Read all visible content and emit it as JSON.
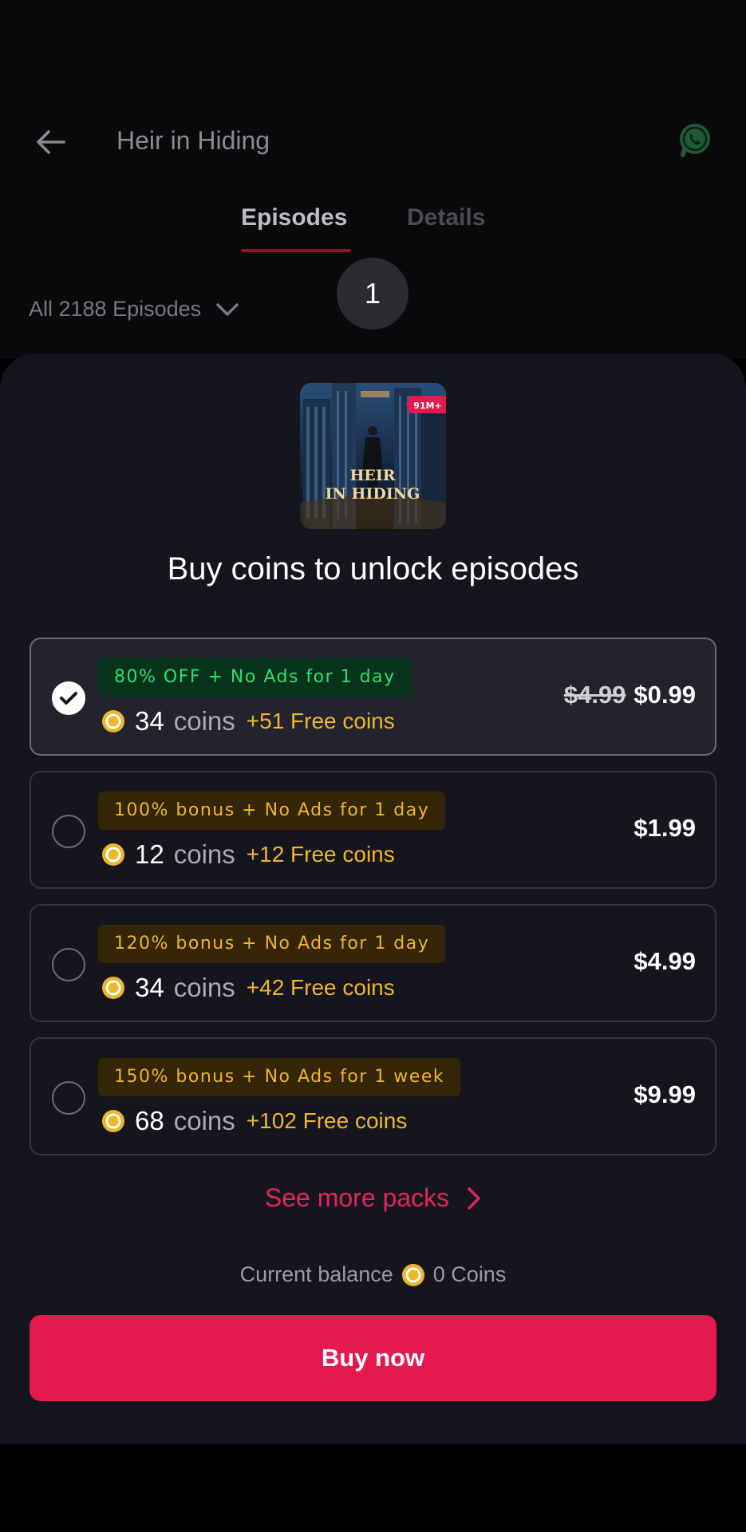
{
  "header": {
    "title": "Heir in Hiding",
    "back_icon": "arrow-left-icon",
    "share_icon": "whatsapp-icon"
  },
  "tabs": [
    {
      "label": "Episodes",
      "active": true
    },
    {
      "label": "Details",
      "active": false
    }
  ],
  "episode_filter": {
    "label": "All 2188 Episodes"
  },
  "current_episode": "1",
  "sheet": {
    "cover": {
      "title_line1": "HEIR",
      "title_line2": "IN HIDING",
      "badge": "91M+"
    },
    "title": "Buy coins to unlock episodes",
    "packs": [
      {
        "badge": "80% OFF + No Ads for 1 day",
        "badge_style": "green",
        "coins": "34",
        "coins_word": "coins",
        "free": "+51 Free coins",
        "old_price": "$4.99",
        "price": "$0.99",
        "selected": true
      },
      {
        "badge": "100% bonus + No Ads for 1 day",
        "badge_style": "gold",
        "coins": "12",
        "coins_word": "coins",
        "free": "+12 Free coins",
        "old_price": "",
        "price": "$1.99",
        "selected": false
      },
      {
        "badge": "120% bonus + No Ads for 1 day",
        "badge_style": "gold",
        "coins": "34",
        "coins_word": "coins",
        "free": "+42 Free coins",
        "old_price": "",
        "price": "$4.99",
        "selected": false
      },
      {
        "badge": "150% bonus + No Ads for 1 week",
        "badge_style": "gold",
        "coins": "68",
        "coins_word": "coins",
        "free": "+102 Free coins",
        "old_price": "",
        "price": "$9.99",
        "selected": false
      }
    ],
    "see_more": "See more packs",
    "balance_label": "Current balance",
    "balance_value": "0 Coins",
    "buy_button": "Buy now"
  },
  "colors": {
    "accent": "#e5194e",
    "coin_gold": "#f2b52a",
    "green_badge": "#2ddf72",
    "sheet_bg": "#15161d"
  }
}
